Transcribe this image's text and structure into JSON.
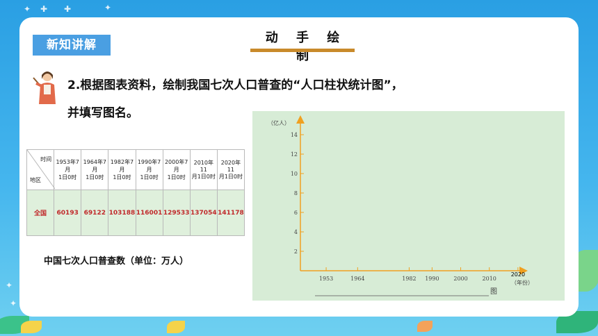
{
  "slide": {
    "section_tag": "新知讲解",
    "title": "动 手 绘 制",
    "question_line1": "2.根据图表资料，绘制我国七次人口普查的“人口柱状统计图”，",
    "question_line2": "并填写图名。",
    "table_caption": "中国七次人口普查数（单位：万人）"
  },
  "table": {
    "corner_top": "时间",
    "corner_bottom": "地区",
    "headers": [
      [
        "1953年7月",
        "1日0时"
      ],
      [
        "1964年7月",
        "1日0时"
      ],
      [
        "1982年7月",
        "1日0时"
      ],
      [
        "1990年7月",
        "1日0时"
      ],
      [
        "2000年7月",
        "1日0时"
      ],
      [
        "2010年11",
        "月1日0时"
      ],
      [
        "2020年11",
        "月1日0时"
      ]
    ],
    "row_label": "全国",
    "values": [
      "60193",
      "69122",
      "103188",
      "116001",
      "129533",
      "137054",
      "141178"
    ]
  },
  "chart_data": {
    "type": "bar",
    "ylabel": "（亿人）",
    "xlabel": "（年份）",
    "ylim": [
      0,
      14
    ],
    "y_ticks": [
      "2",
      "4",
      "6",
      "8",
      "10",
      "12",
      "14"
    ],
    "categories": [
      "1953",
      "1964",
      "1982",
      "1990",
      "2000",
      "2010",
      "2020"
    ],
    "values": [],
    "caption_suffix": "图",
    "grid": false
  },
  "colors": {
    "background": "#2a9fe3",
    "tag": "#4a9fe2",
    "title_bar": "#c98a2b",
    "chart_bg": "#d7ecd6",
    "axis": "#f0a020",
    "table_values": "#c0282a"
  }
}
